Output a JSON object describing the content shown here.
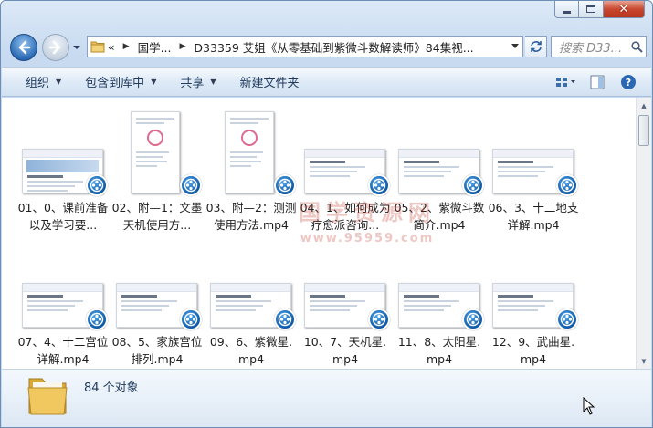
{
  "address": {
    "breadcrumbs": [
      "«",
      "国学...",
      "D33359 艾姐《从零基础到紫微斗数解读师》84集视..."
    ],
    "search_placeholder": "搜索 D33..."
  },
  "commands": [
    "组织",
    "包含到库中",
    "共享",
    "新建文件夹"
  ],
  "files": [
    {
      "name": "01、0、课前准备以及学习要...",
      "thumb": "wide"
    },
    {
      "name": "02、附—1：文墨天机使用方...",
      "thumb": "tall"
    },
    {
      "name": "03、附—2：测测使用方法.mp4",
      "thumb": "tall"
    },
    {
      "name": "04、1、如何成为疗愈派咨询...",
      "thumb": "wide"
    },
    {
      "name": "05、2、紫微斗数简介.mp4",
      "thumb": "wide"
    },
    {
      "name": "06、3、十二地支详解.mp4",
      "thumb": "wide"
    },
    {
      "name": "07、4、十二宫位详解.mp4",
      "thumb": "wide"
    },
    {
      "name": "08、5、家族宫位排列.mp4",
      "thumb": "wide"
    },
    {
      "name": "09、6、紫微星.mp4",
      "thumb": "wide"
    },
    {
      "name": "10、7、天机星.mp4",
      "thumb": "wide"
    },
    {
      "name": "11、8、太阳星.mp4",
      "thumb": "wide"
    },
    {
      "name": "12、9、武曲星.mp4",
      "thumb": "wide"
    }
  ],
  "status": {
    "count_text": "84 个对象"
  },
  "watermark": "国学资源网 www.95959.com",
  "colors": {
    "accent": "#1e395b",
    "badge": "#0f5aa6"
  }
}
